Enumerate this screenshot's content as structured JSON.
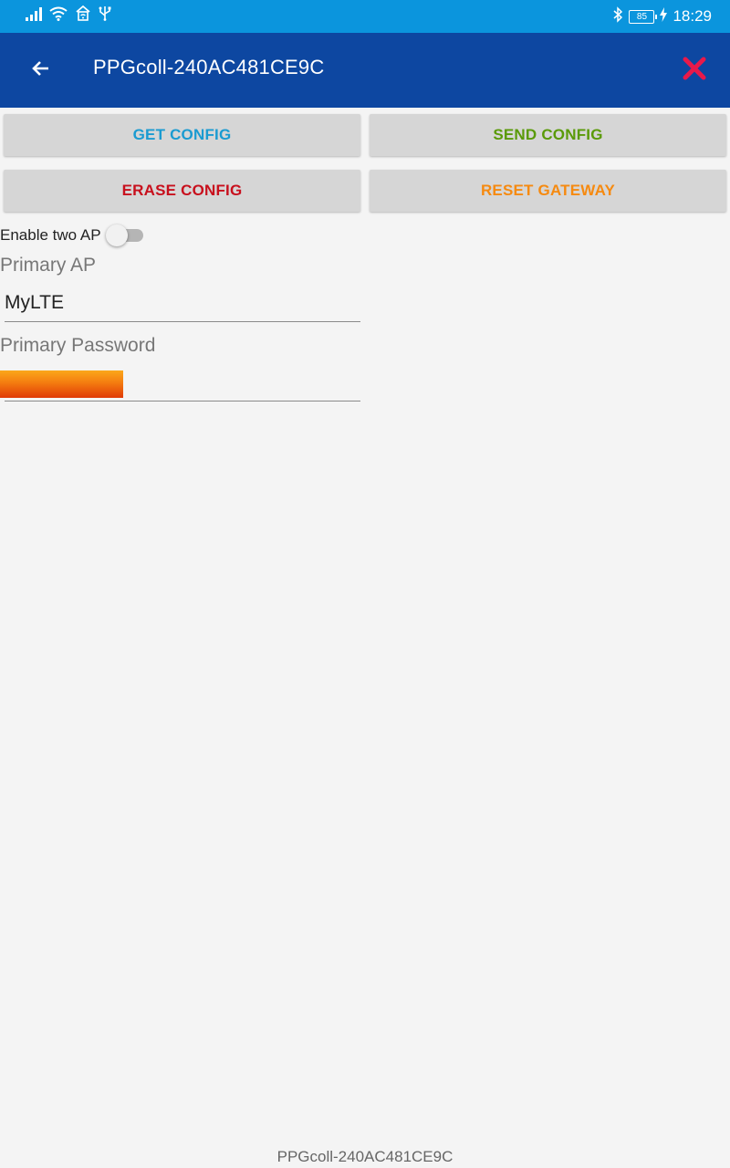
{
  "status_bar": {
    "battery_level": "85",
    "time": "18:29",
    "icons": [
      "signal-icon",
      "wifi-icon",
      "hotspot-icon",
      "usb-icon",
      "bluetooth-icon",
      "battery-icon",
      "charging-icon"
    ]
  },
  "app_bar": {
    "title": "PPGcoll-240AC481CE9C",
    "back_icon": "arrow-left-icon",
    "close_icon": "close-icon",
    "close_color": "#e8194a"
  },
  "buttons": {
    "get_config": {
      "label": "GET CONFIG",
      "color": "#1a9bd1"
    },
    "send_config": {
      "label": "SEND CONFIG",
      "color": "#5a9a08"
    },
    "erase_config": {
      "label": "ERASE CONFIG",
      "color": "#c8101d"
    },
    "reset_gateway": {
      "label": "RESET GATEWAY",
      "color": "#f68a10"
    }
  },
  "form": {
    "enable_two_ap_label": "Enable two AP",
    "enable_two_ap_on": false,
    "primary_ap_label": "Primary AP",
    "primary_ap_value": "MyLTE",
    "primary_password_label": "Primary Password",
    "primary_password_value": ""
  },
  "footer": {
    "device_name": "PPGcoll-240AC481CE9C"
  },
  "colors": {
    "status_bar": "#0b95dd",
    "app_bar": "#0d47a1",
    "background": "#f4f4f4",
    "button_bg": "#d6d6d6"
  }
}
